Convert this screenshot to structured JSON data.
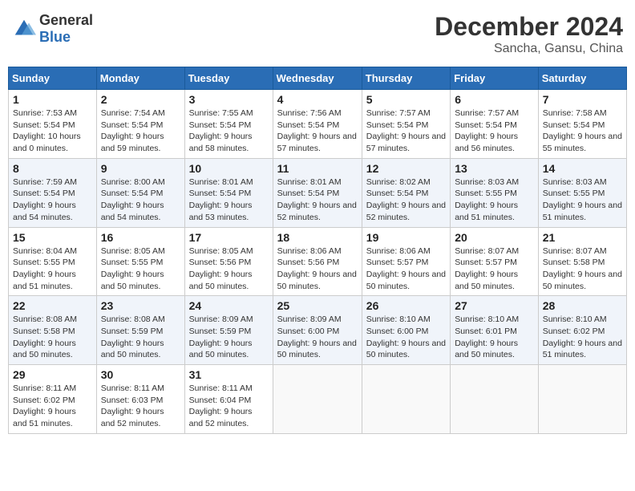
{
  "header": {
    "logo_general": "General",
    "logo_blue": "Blue",
    "month": "December 2024",
    "location": "Sancha, Gansu, China"
  },
  "weekdays": [
    "Sunday",
    "Monday",
    "Tuesday",
    "Wednesday",
    "Thursday",
    "Friday",
    "Saturday"
  ],
  "weeks": [
    [
      {
        "day": "1",
        "sunrise": "7:53 AM",
        "sunset": "5:54 PM",
        "daylight": "10 hours and 0 minutes."
      },
      {
        "day": "2",
        "sunrise": "7:54 AM",
        "sunset": "5:54 PM",
        "daylight": "9 hours and 59 minutes."
      },
      {
        "day": "3",
        "sunrise": "7:55 AM",
        "sunset": "5:54 PM",
        "daylight": "9 hours and 58 minutes."
      },
      {
        "day": "4",
        "sunrise": "7:56 AM",
        "sunset": "5:54 PM",
        "daylight": "9 hours and 57 minutes."
      },
      {
        "day": "5",
        "sunrise": "7:57 AM",
        "sunset": "5:54 PM",
        "daylight": "9 hours and 57 minutes."
      },
      {
        "day": "6",
        "sunrise": "7:57 AM",
        "sunset": "5:54 PM",
        "daylight": "9 hours and 56 minutes."
      },
      {
        "day": "7",
        "sunrise": "7:58 AM",
        "sunset": "5:54 PM",
        "daylight": "9 hours and 55 minutes."
      }
    ],
    [
      {
        "day": "8",
        "sunrise": "7:59 AM",
        "sunset": "5:54 PM",
        "daylight": "9 hours and 54 minutes."
      },
      {
        "day": "9",
        "sunrise": "8:00 AM",
        "sunset": "5:54 PM",
        "daylight": "9 hours and 54 minutes."
      },
      {
        "day": "10",
        "sunrise": "8:01 AM",
        "sunset": "5:54 PM",
        "daylight": "9 hours and 53 minutes."
      },
      {
        "day": "11",
        "sunrise": "8:01 AM",
        "sunset": "5:54 PM",
        "daylight": "9 hours and 52 minutes."
      },
      {
        "day": "12",
        "sunrise": "8:02 AM",
        "sunset": "5:54 PM",
        "daylight": "9 hours and 52 minutes."
      },
      {
        "day": "13",
        "sunrise": "8:03 AM",
        "sunset": "5:55 PM",
        "daylight": "9 hours and 51 minutes."
      },
      {
        "day": "14",
        "sunrise": "8:03 AM",
        "sunset": "5:55 PM",
        "daylight": "9 hours and 51 minutes."
      }
    ],
    [
      {
        "day": "15",
        "sunrise": "8:04 AM",
        "sunset": "5:55 PM",
        "daylight": "9 hours and 51 minutes."
      },
      {
        "day": "16",
        "sunrise": "8:05 AM",
        "sunset": "5:55 PM",
        "daylight": "9 hours and 50 minutes."
      },
      {
        "day": "17",
        "sunrise": "8:05 AM",
        "sunset": "5:56 PM",
        "daylight": "9 hours and 50 minutes."
      },
      {
        "day": "18",
        "sunrise": "8:06 AM",
        "sunset": "5:56 PM",
        "daylight": "9 hours and 50 minutes."
      },
      {
        "day": "19",
        "sunrise": "8:06 AM",
        "sunset": "5:57 PM",
        "daylight": "9 hours and 50 minutes."
      },
      {
        "day": "20",
        "sunrise": "8:07 AM",
        "sunset": "5:57 PM",
        "daylight": "9 hours and 50 minutes."
      },
      {
        "day": "21",
        "sunrise": "8:07 AM",
        "sunset": "5:58 PM",
        "daylight": "9 hours and 50 minutes."
      }
    ],
    [
      {
        "day": "22",
        "sunrise": "8:08 AM",
        "sunset": "5:58 PM",
        "daylight": "9 hours and 50 minutes."
      },
      {
        "day": "23",
        "sunrise": "8:08 AM",
        "sunset": "5:59 PM",
        "daylight": "9 hours and 50 minutes."
      },
      {
        "day": "24",
        "sunrise": "8:09 AM",
        "sunset": "5:59 PM",
        "daylight": "9 hours and 50 minutes."
      },
      {
        "day": "25",
        "sunrise": "8:09 AM",
        "sunset": "6:00 PM",
        "daylight": "9 hours and 50 minutes."
      },
      {
        "day": "26",
        "sunrise": "8:10 AM",
        "sunset": "6:00 PM",
        "daylight": "9 hours and 50 minutes."
      },
      {
        "day": "27",
        "sunrise": "8:10 AM",
        "sunset": "6:01 PM",
        "daylight": "9 hours and 50 minutes."
      },
      {
        "day": "28",
        "sunrise": "8:10 AM",
        "sunset": "6:02 PM",
        "daylight": "9 hours and 51 minutes."
      }
    ],
    [
      {
        "day": "29",
        "sunrise": "8:11 AM",
        "sunset": "6:02 PM",
        "daylight": "9 hours and 51 minutes."
      },
      {
        "day": "30",
        "sunrise": "8:11 AM",
        "sunset": "6:03 PM",
        "daylight": "9 hours and 52 minutes."
      },
      {
        "day": "31",
        "sunrise": "8:11 AM",
        "sunset": "6:04 PM",
        "daylight": "9 hours and 52 minutes."
      },
      null,
      null,
      null,
      null
    ]
  ]
}
